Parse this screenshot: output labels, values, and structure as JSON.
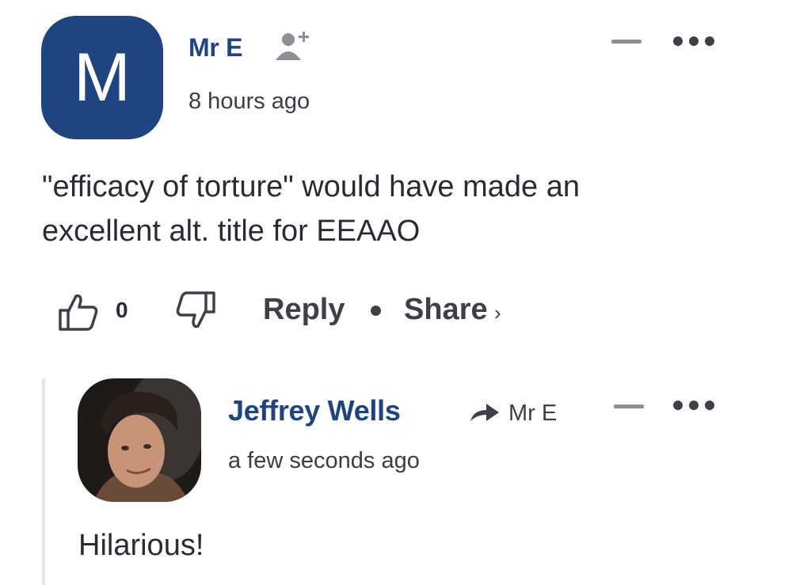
{
  "comment": {
    "avatar_letter": "M",
    "author": "Mr E",
    "time": "8 hours ago",
    "text_line1": "\"efficacy of torture\" would have made an",
    "text_line2": "excellent alt. title for EEAAO",
    "like_count": "0",
    "reply_label": "Reply",
    "share_label": "Share",
    "share_chevron": "›",
    "icons": [
      "follow-user-icon",
      "collapse-icon",
      "more-options-icon",
      "thumbs-up-icon",
      "thumbs-down-icon"
    ]
  },
  "reply": {
    "author": "Jeffrey Wells",
    "reply_to": "Mr E",
    "time": "a few seconds ago",
    "text": "Hilarious!",
    "icons": [
      "reply-arrow-icon",
      "collapse-icon",
      "more-options-icon"
    ]
  },
  "colors": {
    "brand_blue": "#1f4580",
    "text": "#2a2c33",
    "muted": "#8c8f96",
    "thread_line": "#e4e6ea"
  }
}
